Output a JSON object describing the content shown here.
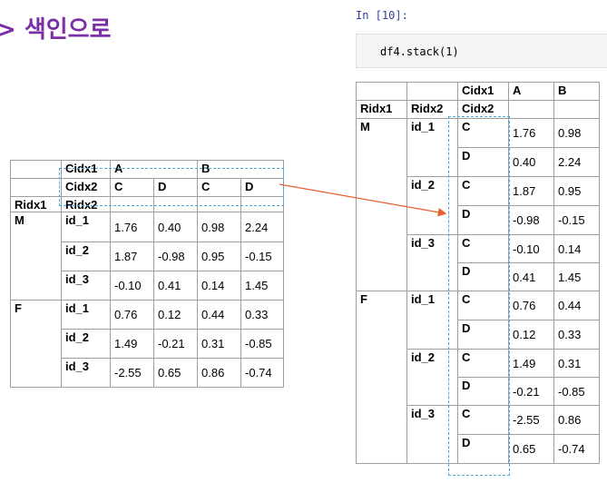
{
  "heading": "> 색인으로",
  "notebook": {
    "prompt": "In [10]:",
    "code": "df4.stack(1)"
  },
  "left_table": {
    "cidx1_label": "Cidx1",
    "cidx2_label": "Cidx2",
    "ridx1_label": "Ridx1",
    "ridx2_label": "Ridx2",
    "top_cols": [
      "A",
      "B"
    ],
    "sub_cols": [
      "C",
      "D",
      "C",
      "D"
    ],
    "groups": [
      {
        "ridx1": "M",
        "rows": [
          {
            "ridx2": "id_1",
            "values": [
              "1.76",
              "0.40",
              "0.98",
              "2.24"
            ]
          },
          {
            "ridx2": "id_2",
            "values": [
              "1.87",
              "-0.98",
              "0.95",
              "-0.15"
            ]
          },
          {
            "ridx2": "id_3",
            "values": [
              "-0.10",
              "0.41",
              "0.14",
              "1.45"
            ]
          }
        ]
      },
      {
        "ridx1": "F",
        "rows": [
          {
            "ridx2": "id_1",
            "values": [
              "0.76",
              "0.12",
              "0.44",
              "0.33"
            ]
          },
          {
            "ridx2": "id_2",
            "values": [
              "1.49",
              "-0.21",
              "0.31",
              "-0.85"
            ]
          },
          {
            "ridx2": "id_3",
            "values": [
              "-2.55",
              "0.65",
              "0.86",
              "-0.74"
            ]
          }
        ]
      }
    ]
  },
  "right_table": {
    "cidx1_label": "Cidx1",
    "cidx2_label": "Cidx2",
    "ridx1_label": "Ridx1",
    "ridx2_label": "Ridx2",
    "cols": [
      "A",
      "B"
    ],
    "groups": [
      {
        "ridx1": "M",
        "subgroups": [
          {
            "ridx2": "id_1",
            "rows": [
              {
                "cidx2": "C",
                "values": [
                  "1.76",
                  "0.98"
                ]
              },
              {
                "cidx2": "D",
                "values": [
                  "0.40",
                  "2.24"
                ]
              }
            ]
          },
          {
            "ridx2": "id_2",
            "rows": [
              {
                "cidx2": "C",
                "values": [
                  "1.87",
                  "0.95"
                ]
              },
              {
                "cidx2": "D",
                "values": [
                  "-0.98",
                  "-0.15"
                ]
              }
            ]
          },
          {
            "ridx2": "id_3",
            "rows": [
              {
                "cidx2": "C",
                "values": [
                  "-0.10",
                  "0.14"
                ]
              },
              {
                "cidx2": "D",
                "values": [
                  "0.41",
                  "1.45"
                ]
              }
            ]
          }
        ]
      },
      {
        "ridx1": "F",
        "subgroups": [
          {
            "ridx2": "id_1",
            "rows": [
              {
                "cidx2": "C",
                "values": [
                  "0.76",
                  "0.44"
                ]
              },
              {
                "cidx2": "D",
                "values": [
                  "0.12",
                  "0.33"
                ]
              }
            ]
          },
          {
            "ridx2": "id_2",
            "rows": [
              {
                "cidx2": "C",
                "values": [
                  "1.49",
                  "0.31"
                ]
              },
              {
                "cidx2": "D",
                "values": [
                  "-0.21",
                  "-0.85"
                ]
              }
            ]
          },
          {
            "ridx2": "id_3",
            "rows": [
              {
                "cidx2": "C",
                "values": [
                  "-2.55",
                  "0.86"
                ]
              },
              {
                "cidx2": "D",
                "values": [
                  "0.65",
                  "-0.74"
                ]
              }
            ]
          }
        ]
      }
    ]
  },
  "colors": {
    "heading": "#7a2fa6",
    "dashed_box": "#4ea7d8",
    "arrow": "#e8612c",
    "prompt": "#303f9f"
  }
}
